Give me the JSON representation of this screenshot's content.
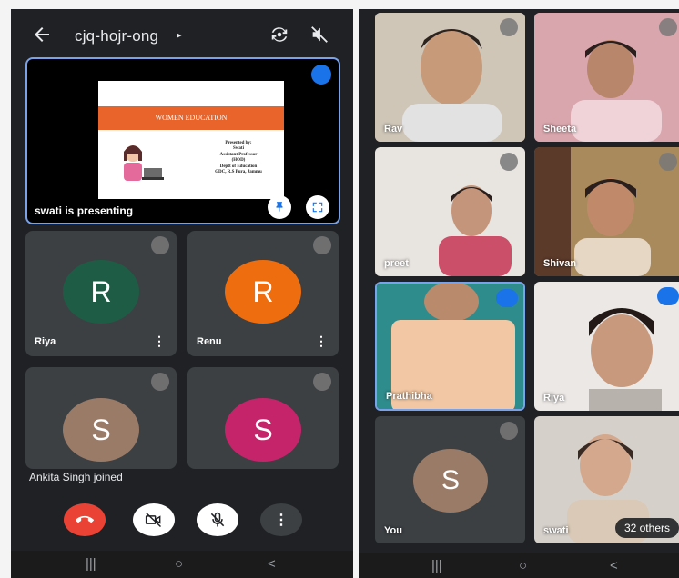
{
  "left_phone": {
    "app_bar": {
      "meeting_code": "cjq-hojr-ong",
      "caret": "▸"
    },
    "presentation": {
      "slide": {
        "title": "WOMEN EDUCATION",
        "details": [
          "Presented by:",
          "Swati",
          "Assistant Professor",
          "(HOD)",
          "Deptt of Education",
          "GDC, R.S Pura, Jammu"
        ]
      },
      "caption": "swati is presenting"
    },
    "tiles": [
      {
        "initial": "R",
        "name": "Riya",
        "color": "#1e5c45",
        "menu": "⋮"
      },
      {
        "initial": "R",
        "name": "Renu",
        "color": "#ee6d0e",
        "menu": "⋮"
      },
      {
        "initial": "S",
        "name": "",
        "color": "#9a7b68"
      },
      {
        "initial": "S",
        "name": "",
        "color": "#c5246b"
      }
    ],
    "toast": "Ankita Singh joined",
    "controls": {
      "end_call_color": "#ea4335",
      "more_label": "⋮"
    },
    "nav": {
      "recents": "|||",
      "home": "○",
      "back": "<"
    }
  },
  "right_phone": {
    "tiles": [
      {
        "name": "Rav",
        "icon": "mic-off-icon"
      },
      {
        "name": "Sheeta",
        "icon": "mic-off-icon"
      },
      {
        "name": "preet",
        "icon": "mic-off-icon"
      },
      {
        "name": "Shivan",
        "icon": "mic-off-icon"
      },
      {
        "name": "Prathibha",
        "icon": "speaking-icon"
      },
      {
        "name": "Riya",
        "icon": "speaking-icon"
      },
      {
        "name": "You",
        "initial": "S",
        "color": "#9a7b68",
        "icon": "mic-off-icon"
      },
      {
        "name": "swati",
        "others": "32 others"
      }
    ],
    "nav": {
      "recents": "|||",
      "home": "○",
      "back": "<"
    }
  }
}
